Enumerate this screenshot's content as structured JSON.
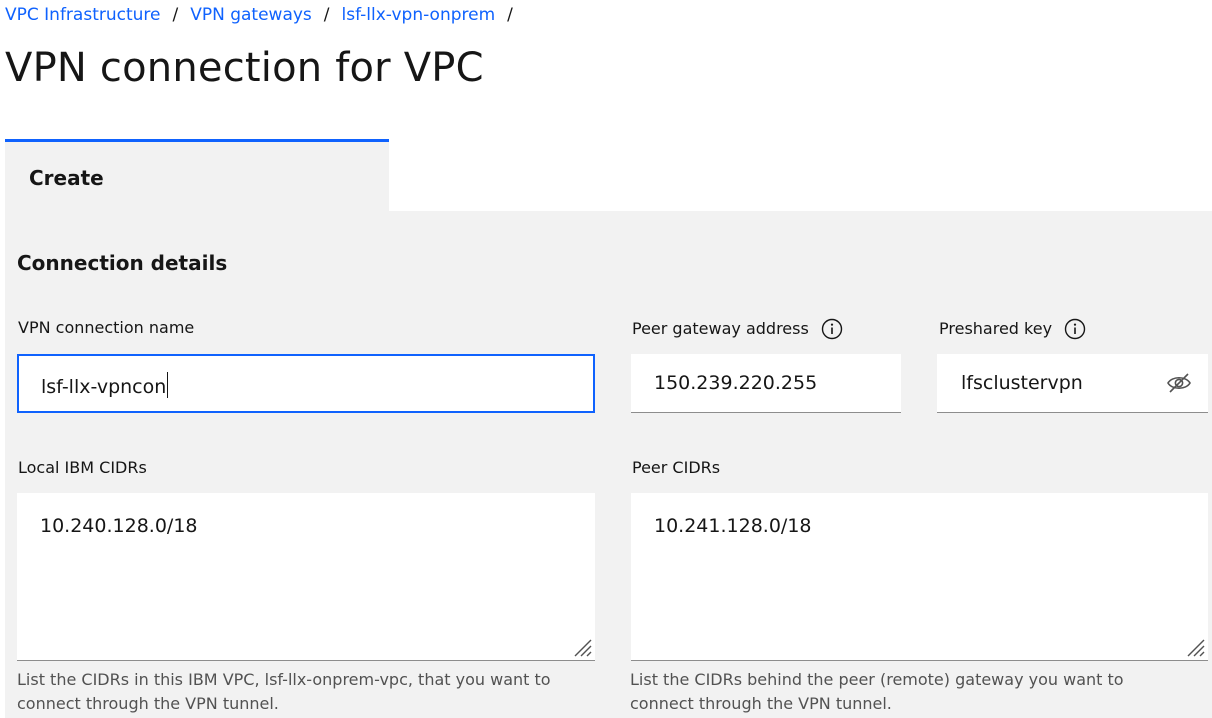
{
  "breadcrumb": {
    "items": [
      "VPC Infrastructure",
      "VPN gateways",
      "lsf-llx-vpn-onprem"
    ],
    "separator": "/"
  },
  "page_title": "VPN connection for VPC",
  "tab": {
    "label": "Create"
  },
  "section": {
    "title": "Connection details"
  },
  "form": {
    "connection_name": {
      "label": "VPN connection name",
      "value": "lsf-llx-vpncon"
    },
    "peer_gateway": {
      "label": "Peer gateway address",
      "value": "150.239.220.255",
      "icon": "info-icon"
    },
    "preshared_key": {
      "label": "Preshared key",
      "value": "lfsclustervpn",
      "icon": "info-icon",
      "toggle_icon": "eye-off-icon"
    },
    "local_cidrs": {
      "label": "Local IBM CIDRs",
      "value": "10.240.128.0/18",
      "helper": "List the CIDRs in this IBM VPC, lsf-llx-onprem-vpc, that you want to connect through the VPN tunnel."
    },
    "peer_cidrs": {
      "label": "Peer CIDRs",
      "value": "10.241.128.0/18",
      "helper": "List the CIDRs behind the peer (remote) gateway you want to connect through the VPN tunnel."
    }
  },
  "colors": {
    "link": "#0f62fe",
    "panel": "#f2f2f2",
    "focus": "#0f62fe",
    "helper_text": "#525252"
  }
}
